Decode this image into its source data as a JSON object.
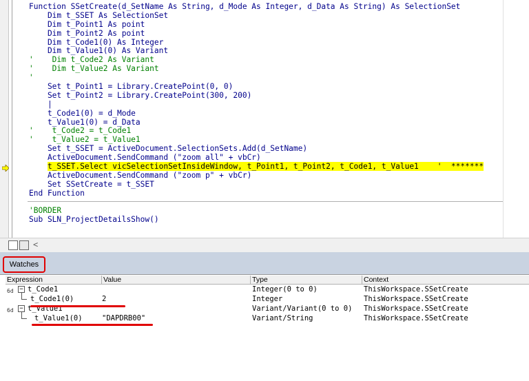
{
  "editor": {
    "lines": [
      {
        "segments": [
          {
            "t": "Function SSetCreate(d_SetName As String, d_Mode As Integer, d_Data As String) As SelectionSet",
            "c": "kw"
          }
        ]
      },
      {
        "segments": [
          {
            "t": "    Dim t_SSET As SelectionSet",
            "c": "kw"
          }
        ]
      },
      {
        "segments": [
          {
            "t": "    Dim t_Point1 As point",
            "c": "kw"
          }
        ]
      },
      {
        "segments": [
          {
            "t": "    Dim t_Point2 As point",
            "c": "kw"
          }
        ]
      },
      {
        "segments": [
          {
            "t": "    Dim t_Code1(0) As Integer",
            "c": "kw"
          }
        ]
      },
      {
        "segments": [
          {
            "t": "    Dim t_Value1(0) As Variant",
            "c": "kw"
          }
        ]
      },
      {
        "segments": [
          {
            "t": "'    Dim t_Code2 As Variant",
            "c": "cm"
          }
        ]
      },
      {
        "segments": [
          {
            "t": "'    Dim t_Value2 As Variant",
            "c": "cm"
          }
        ]
      },
      {
        "segments": [
          {
            "t": "'",
            "c": "cm"
          }
        ]
      },
      {
        "segments": [
          {
            "t": "    Set t_Point1 = Library.CreatePoint(0, 0)",
            "c": "kw"
          }
        ]
      },
      {
        "segments": [
          {
            "t": "    Set t_Point2 = Library.CreatePoint(300, 200)",
            "c": "kw"
          }
        ]
      },
      {
        "segments": [
          {
            "t": "    |",
            "c": "kw"
          }
        ]
      },
      {
        "segments": [
          {
            "t": "    t_Code1(0) = d_Mode",
            "c": "kw"
          }
        ]
      },
      {
        "segments": [
          {
            "t": "    t_Value1(0) = d_Data",
            "c": "kw"
          }
        ]
      },
      {
        "segments": [
          {
            "t": "'    t_Code2 = t_Code1",
            "c": "cm"
          }
        ]
      },
      {
        "segments": [
          {
            "t": "'    t_Value2 = t_Value1",
            "c": "cm"
          }
        ]
      },
      {
        "segments": [
          {
            "t": "    Set t_SSET = ActiveDocument.SelectionSets.Add(d_SetName)",
            "c": "kw"
          }
        ]
      },
      {
        "segments": [
          {
            "t": "    ActiveDocument.SendCommand (\"zoom all\" + vbCr)",
            "c": "kw"
          }
        ]
      },
      {
        "segments": [
          {
            "t": "    ",
            "c": "kw"
          },
          {
            "t": "t_SSET.Select vicSelectionSetInsideWindow, t_Point1, t_Point2, t_Code1, t_Value1    '  *******",
            "c": "hl"
          }
        ]
      },
      {
        "segments": [
          {
            "t": "    ActiveDocument.SendCommand (\"zoom p\" + vbCr)",
            "c": "kw"
          }
        ]
      },
      {
        "segments": [
          {
            "t": "    Set SSetCreate = t_SSET",
            "c": "kw"
          }
        ]
      },
      {
        "segments": [
          {
            "t": "End Function",
            "c": "kw"
          }
        ]
      },
      {
        "segments": [
          {
            "t": "",
            "c": "kw"
          }
        ]
      },
      {
        "segments": [
          {
            "t": "'BORDER",
            "c": "cm"
          }
        ]
      },
      {
        "segments": [
          {
            "t": "Sub SLN_ProjectDetailsShow()",
            "c": "kw"
          }
        ]
      }
    ],
    "scroll_left_glyph": "<"
  },
  "watches": {
    "title": "Watches",
    "headers": {
      "expression": "Expression",
      "value": "Value",
      "type": "Type",
      "context": "Context"
    },
    "rows": [
      {
        "expander": "−",
        "expression": "t_Code1",
        "value": "",
        "type": "Integer(0 to 0)",
        "context": "ThisWorkspace.SSetCreate"
      },
      {
        "expander": "",
        "expression": "t_Code1(0)",
        "value": "2",
        "type": "Integer",
        "context": "ThisWorkspace.SSetCreate"
      },
      {
        "expander": "−",
        "expression": "t_Value1",
        "value": "",
        "type": "Variant/Variant(0 to 0)",
        "context": "ThisWorkspace.SSetCreate"
      },
      {
        "expander": "",
        "expression": "t_Value1(0)",
        "value": "\"DAPDRB00\"",
        "type": "Variant/String",
        "context": "ThisWorkspace.SSetCreate"
      }
    ]
  },
  "colors": {
    "keyword": "#00008b",
    "comment": "#008000",
    "highlight": "#ffff00",
    "annotation": "#e00000"
  }
}
